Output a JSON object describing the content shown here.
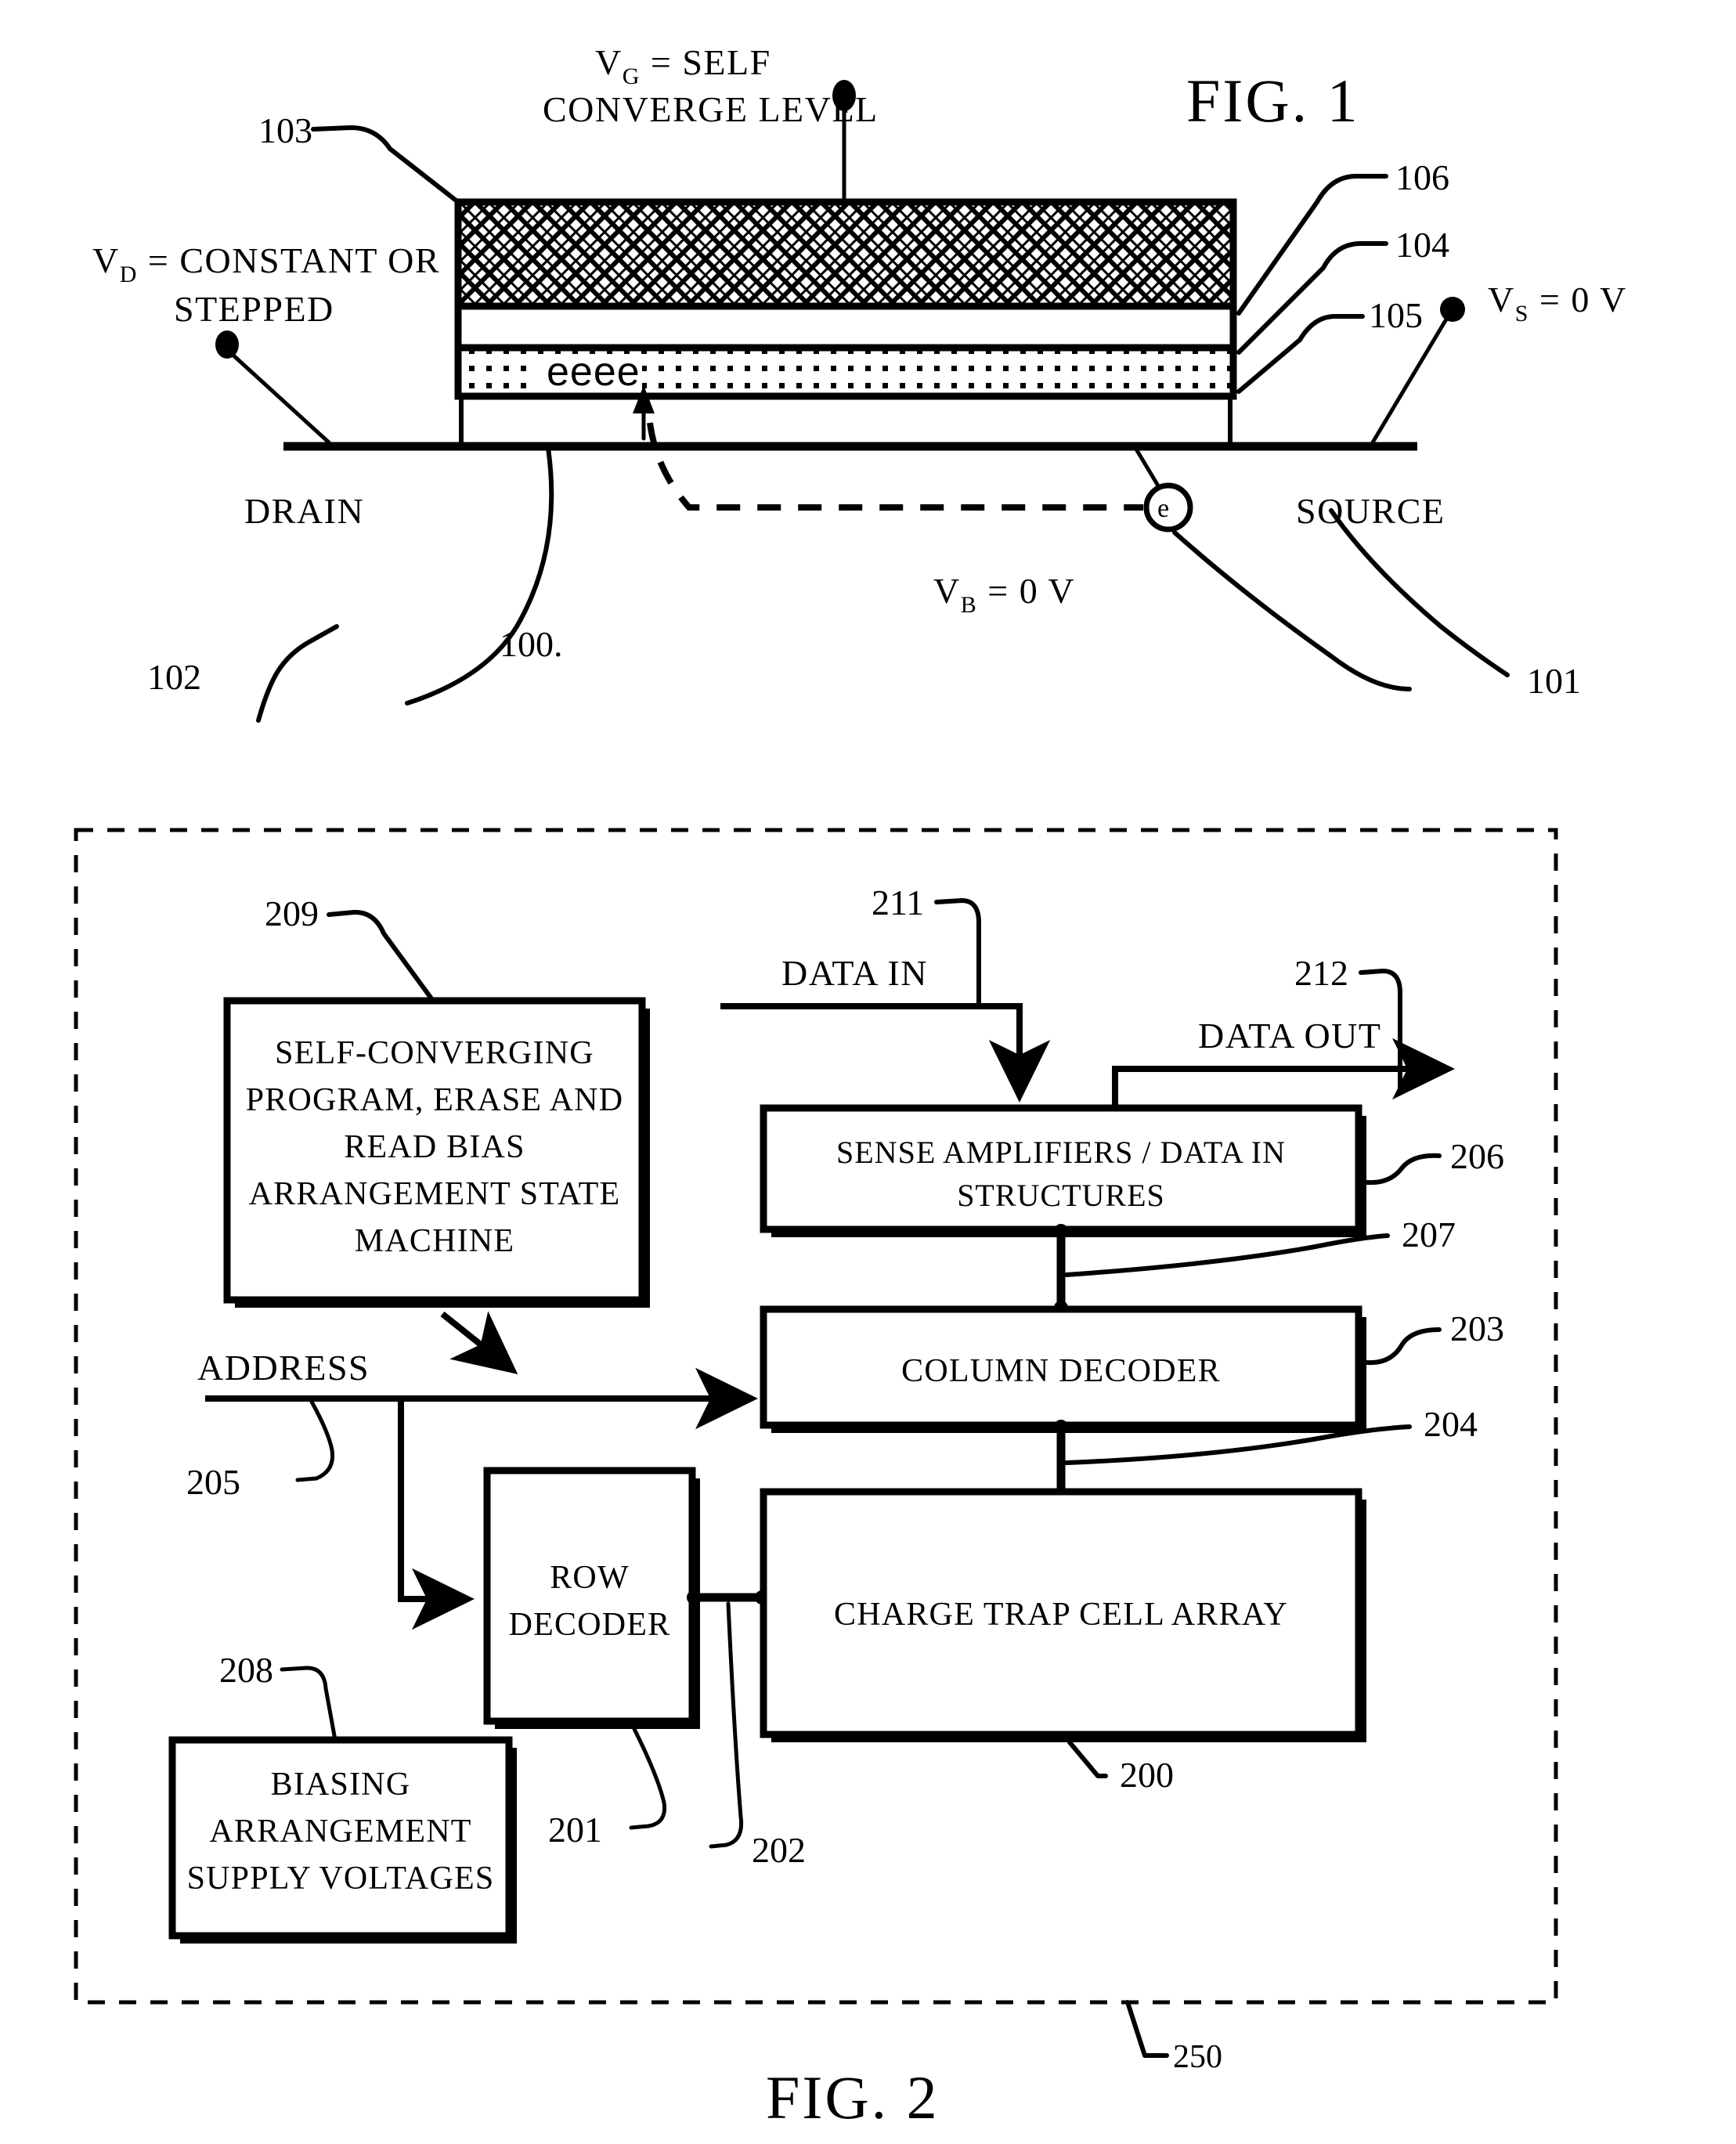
{
  "figure1": {
    "title": "FIG. 1",
    "gate_label_line1": "V",
    "gate_label_sub": "G",
    "gate_label_line1b": " = SELF",
    "gate_label_line2": "CONVERGE LEVEL",
    "drain_bias_line1_v": "V",
    "drain_bias_line1_sub": "D",
    "drain_bias_line1_rest": " = CONSTANT OR",
    "drain_bias_line2": "STEPPED",
    "source_bias_v": "V",
    "source_bias_sub": "S",
    "source_bias_rest": " = 0  V",
    "body_bias_v": "V",
    "body_bias_sub": "B",
    "body_bias_rest": " = 0  V",
    "drain_terminal_label": "DRAIN",
    "source_terminal_label": "SOURCE",
    "trapped_charge_label": "eeee",
    "electron_label": "e",
    "refs": {
      "gate": "103",
      "drain": "102",
      "source": "101",
      "device": "100.",
      "top_layer": "106",
      "mid_layer": "104",
      "trap_layer": "105"
    }
  },
  "figure2": {
    "title": "FIG. 2",
    "chip_ref": "250",
    "blocks": {
      "state_machine": {
        "ref": "209",
        "lines": [
          "SELF-CONVERGING",
          "PROGRAM,  ERASE AND",
          "READ BIAS",
          "ARRANGEMENT STATE",
          "MACHINE"
        ]
      },
      "sense_amps": {
        "ref": "206",
        "lines": [
          "SENSE AMPLIFIERS / DATA IN",
          "STRUCTURES"
        ]
      },
      "column_decoder": {
        "ref": "203",
        "lines": [
          "COLUMN DECODER"
        ]
      },
      "row_decoder": {
        "ref": "201",
        "lines": [
          "ROW",
          "DECODER"
        ]
      },
      "cell_array": {
        "ref": "200",
        "lines": [
          "CHARGE TRAP CELL ARRAY"
        ]
      },
      "biasing": {
        "ref": "208",
        "lines": [
          "BIASING",
          "ARRANGEMENT",
          "SUPPLY VOLTAGES"
        ]
      }
    },
    "signals": {
      "data_in": {
        "label": "DATA IN",
        "ref": "211"
      },
      "data_out": {
        "label": "DATA OUT",
        "ref": "212"
      },
      "address": {
        "label": "ADDRESS",
        "ref": "205"
      },
      "bitline_bus_ref": "207",
      "column_bus_ref": "204",
      "wordline_bus_ref": "202"
    }
  },
  "colors": {
    "ink": "#000000",
    "paper": "#ffffff"
  }
}
